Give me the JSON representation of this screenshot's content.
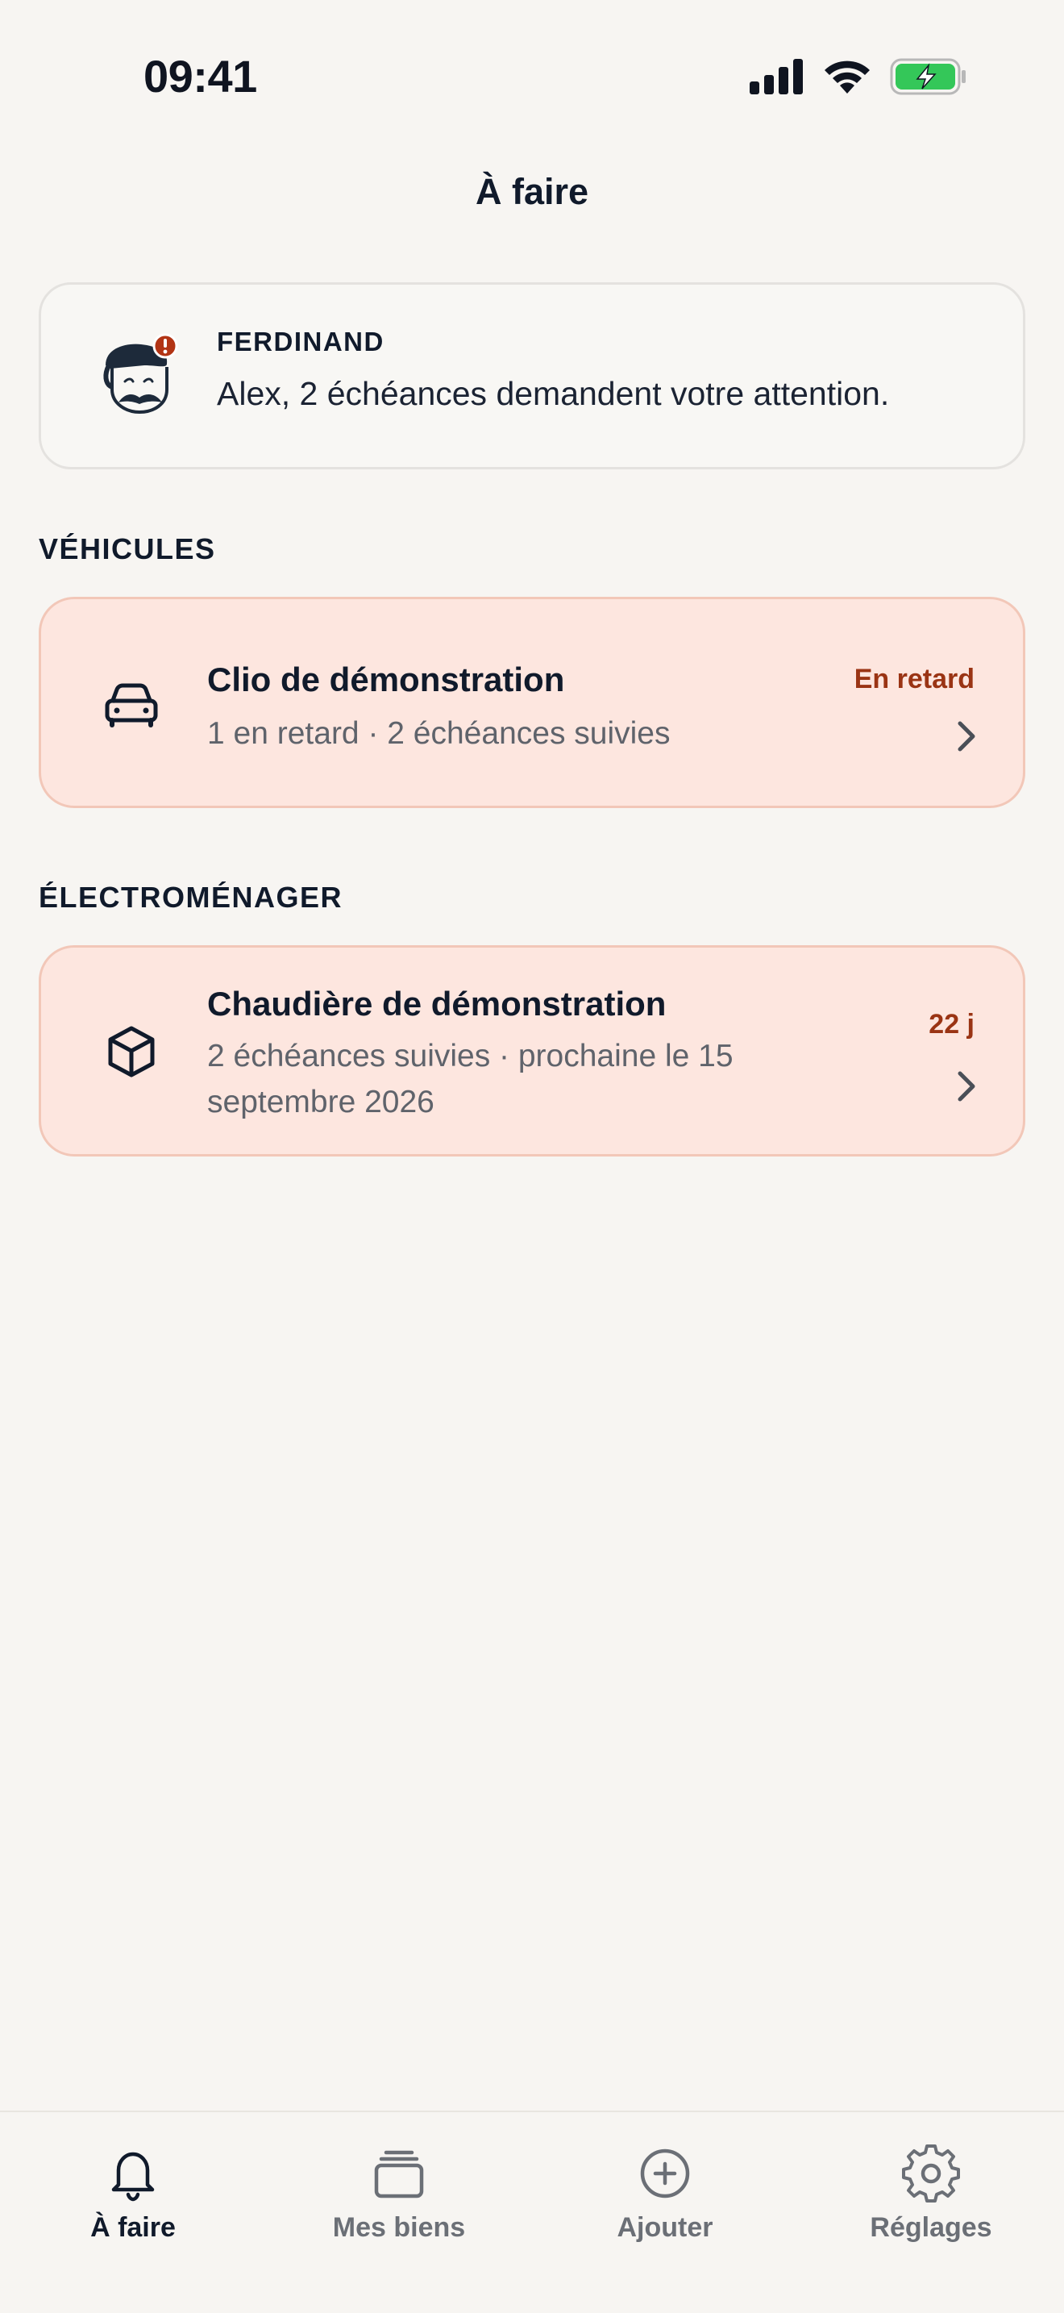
{
  "status_bar": {
    "time": "09:41"
  },
  "header": {
    "title": "À faire"
  },
  "assistant": {
    "name": "FERDINAND",
    "message": "Alex, 2 échéances demandent votre attention."
  },
  "sections": [
    {
      "label": "VÉHICULES",
      "items": [
        {
          "title": "Clio de démonstration",
          "subtitle": "1 en retard · 2 échéances suivies",
          "badge": "En retard",
          "icon": "car-icon"
        }
      ]
    },
    {
      "label": "ÉLECTROMÉNAGER",
      "items": [
        {
          "title": "Chaudière de démonstration",
          "subtitle": "2 échéances suivies · prochaine le 15 septembre 2026",
          "badge": "22 j",
          "icon": "box-icon"
        }
      ]
    }
  ],
  "tab_bar": {
    "tabs": [
      {
        "label": "À faire",
        "icon": "bell-icon",
        "active": true
      },
      {
        "label": "Mes biens",
        "icon": "stack-icon",
        "active": false
      },
      {
        "label": "Ajouter",
        "icon": "plus-circle-icon",
        "active": false
      },
      {
        "label": "Réglages",
        "icon": "gear-icon",
        "active": false
      }
    ]
  },
  "colors": {
    "background": "#f7f5f2",
    "card_alert_bg": "#fde6df",
    "card_alert_border": "#f2c7b8",
    "badge_text": "#9a3414",
    "battery_green": "#34c759",
    "text_primary": "#101a2b"
  }
}
